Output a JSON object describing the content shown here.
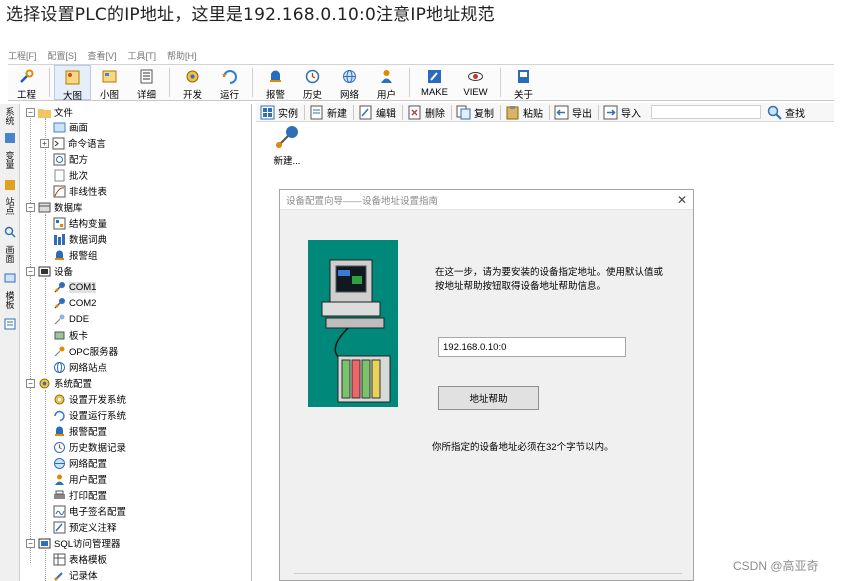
{
  "caption": "选择设置PLC的IP地址，这里是192.168.0.10:0注意IP地址规范",
  "menu": [
    "工程[F]",
    "配置[S]",
    "查看[V]",
    "工具[T]",
    "帮助[H]"
  ],
  "toolbar": {
    "items": [
      {
        "label": "工程",
        "icon": "wrench-icon"
      },
      {
        "label": "大图",
        "icon": "large-icon-view-icon"
      },
      {
        "label": "小图",
        "icon": "small-icon-view-icon"
      },
      {
        "label": "详细",
        "icon": "details-view-icon"
      },
      {
        "label": "开发",
        "icon": "gear-develop-icon"
      },
      {
        "label": "运行",
        "icon": "run-icon"
      },
      {
        "label": "报警",
        "icon": "alarm-bell-icon"
      },
      {
        "label": "历史",
        "icon": "history-clock-icon"
      },
      {
        "label": "网络",
        "icon": "network-globe-icon"
      },
      {
        "label": "用户",
        "icon": "user-icon"
      },
      {
        "label": "MAKE",
        "icon": "make-pencil-icon"
      },
      {
        "label": "VIEW",
        "icon": "view-eye-icon"
      },
      {
        "label": "关于",
        "icon": "about-book-icon"
      }
    ]
  },
  "vtabs": [
    "系统",
    "变量",
    "站点",
    "画面",
    "模板"
  ],
  "tree": {
    "file": "文件",
    "screen": "画面",
    "command_lang": "命令语言",
    "recipe": "配方",
    "batch": "批次",
    "nonlinear": "非线性表",
    "database": "数据库",
    "struct_var": "结构变量",
    "data_dict": "数据词典",
    "alarm_group": "报警组",
    "device": "设备",
    "com1": "COM1",
    "com2": "COM2",
    "dde": "DDE",
    "board": "板卡",
    "opc": "OPC服务器",
    "net_station": "网络站点",
    "sys_config": "系统配置",
    "dev_sys": "设置开发系统",
    "run_sys": "设置运行系统",
    "alarm_cfg": "报警配置",
    "hist_cfg": "历史数据记录",
    "net_cfg": "网络配置",
    "user_cfg": "用户配置",
    "print_cfg": "打印配置",
    "esign_cfg": "电子签名配置",
    "predef_note": "预定义注释",
    "sql_mgr": "SQL访问管理器",
    "table_tpl": "表格模板",
    "recordset": "记录体"
  },
  "rtoolbar": {
    "instance": "实例",
    "new": "新建",
    "edit": "编辑",
    "delete": "删除",
    "copy": "复制",
    "paste": "粘贴",
    "export": "导出",
    "import": "导入",
    "find": "查找",
    "search_value": ""
  },
  "new_item": "新建...",
  "dialog": {
    "title": "设备配置向导——设备地址设置指南",
    "instruction": "在这一步，请为要安装的设备指定地址。使用默认值或按地址帮助按钮取得设备地址帮助信息。",
    "address_value": "192.168.0.10:0",
    "help_button": "地址帮助",
    "note": "你所指定的设备地址必须在32个字节以内。"
  },
  "watermark": "CSDN @高亚奇",
  "colors": {
    "illustration_bg": "#00897a",
    "window_bg": "#f0f0f0"
  }
}
